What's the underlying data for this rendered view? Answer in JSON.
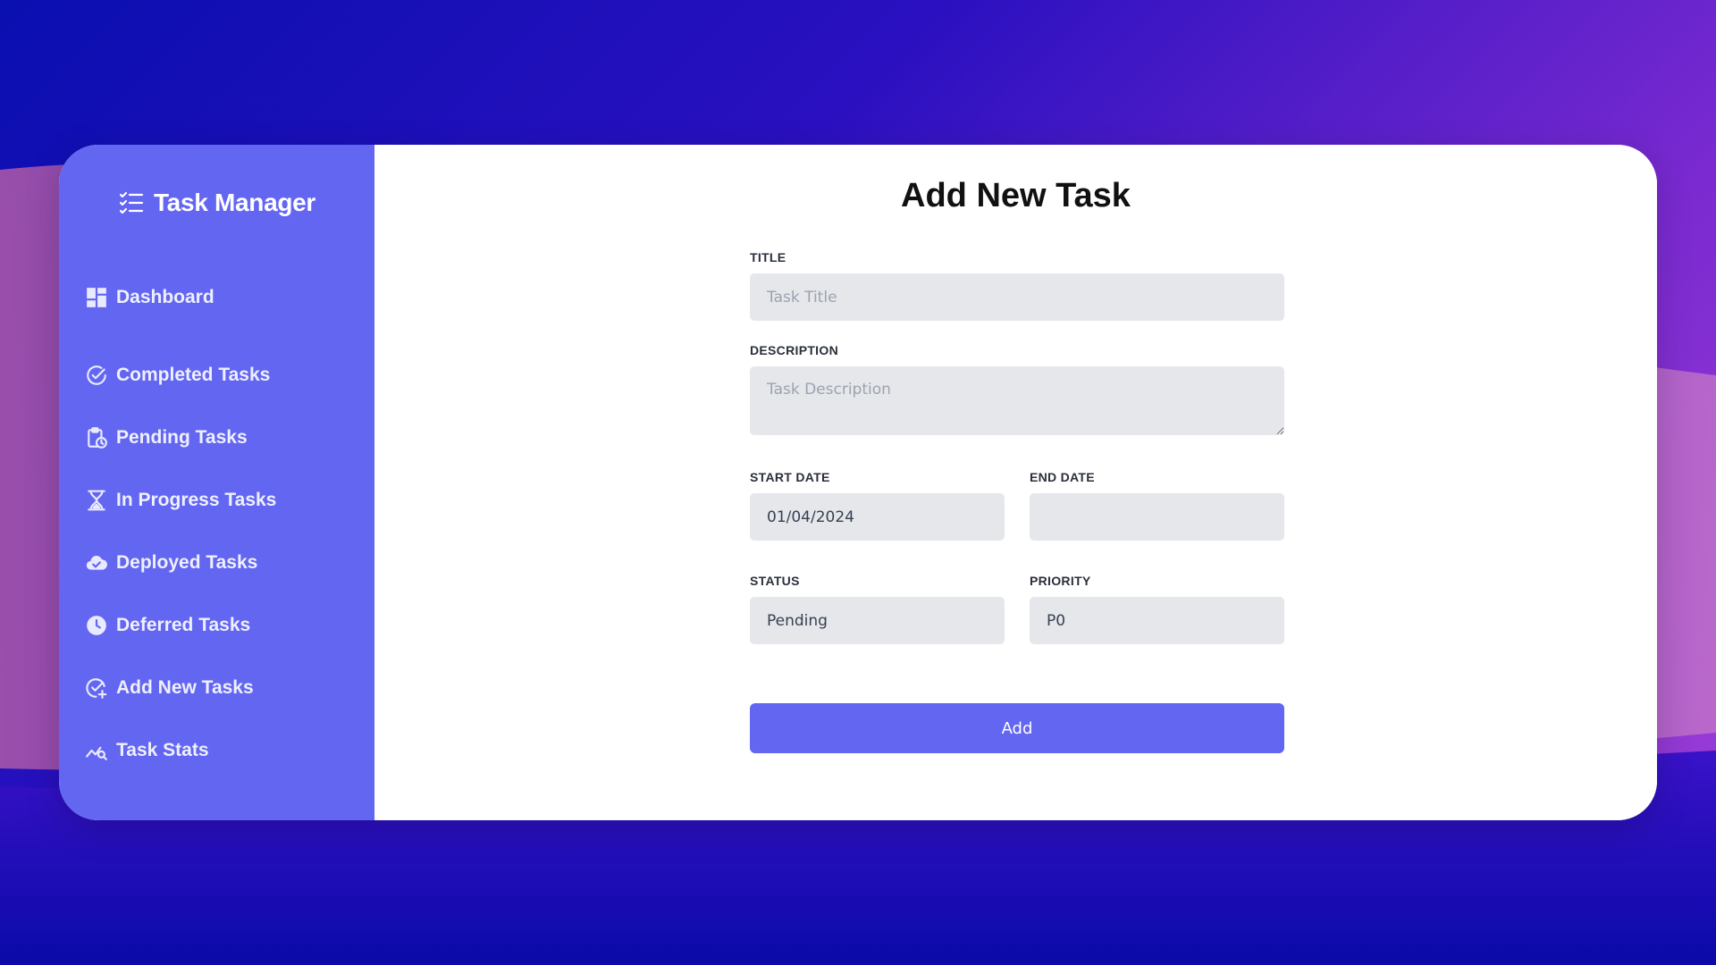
{
  "theme": {
    "accent": "#6366f1",
    "input_bg": "#e5e7eb",
    "panel_bg": "#ffffff"
  },
  "sidebar": {
    "brand": {
      "title": "Task Manager",
      "icon": "checklist-icon"
    },
    "items": [
      {
        "label": "Dashboard",
        "icon": "dashboard-icon"
      },
      {
        "label": "Completed Tasks",
        "icon": "check-circle-icon"
      },
      {
        "label": "Pending Tasks",
        "icon": "clipboard-clock-icon"
      },
      {
        "label": "In Progress Tasks",
        "icon": "hourglass-icon"
      },
      {
        "label": "Deployed Tasks",
        "icon": "cloud-check-icon"
      },
      {
        "label": "Deferred Tasks",
        "icon": "clock-icon"
      },
      {
        "label": "Add New Tasks",
        "icon": "check-plus-icon"
      },
      {
        "label": "Task Stats",
        "icon": "chart-search-icon"
      }
    ]
  },
  "main": {
    "title": "Add New Task",
    "form": {
      "title": {
        "label": "TITLE",
        "value": "",
        "placeholder": "Task Title"
      },
      "description": {
        "label": "DESCRIPTION",
        "value": "",
        "placeholder": "Task Description"
      },
      "start_date": {
        "label": "START DATE",
        "value": "01/04/2024"
      },
      "end_date": {
        "label": "END DATE",
        "value": ""
      },
      "status": {
        "label": "STATUS",
        "value": "Pending"
      },
      "priority": {
        "label": "PRIORITY",
        "value": "P0"
      },
      "submit_label": "Add"
    }
  }
}
